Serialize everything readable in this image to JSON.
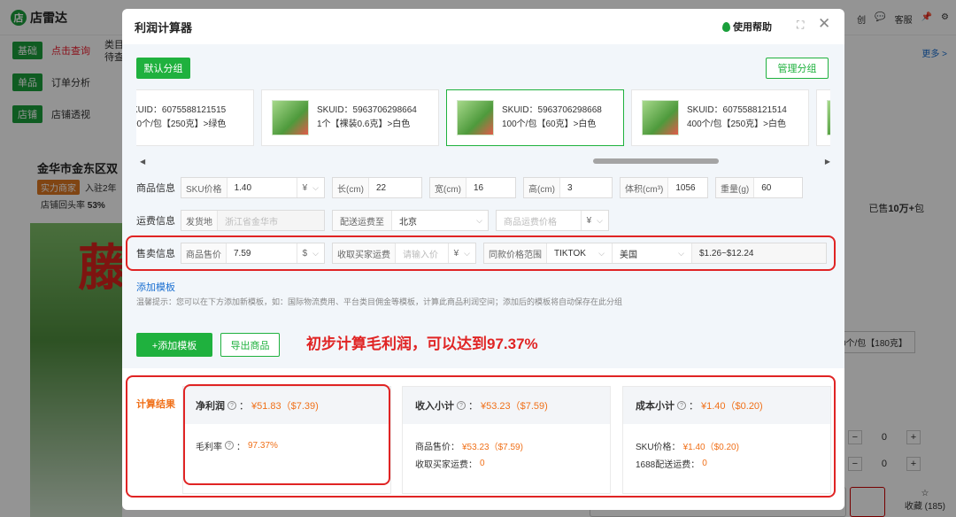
{
  "background": {
    "logo": "店雷达",
    "top_right": [
      "创",
      "客服"
    ],
    "nav": [
      {
        "tag": "基础",
        "link": "点击查询",
        "link_red": true
      },
      {
        "tag": "单品",
        "link": "订单分析",
        "extra": "SKU"
      },
      {
        "tag": "店铺",
        "link": "店铺透视",
        "extra": "店铺"
      }
    ],
    "col_head_1": "类目",
    "col_head_2": "待查",
    "more": "更多 >",
    "shop_name": "金华市金东区双",
    "badge_strong": "实力商家",
    "badge_years": "入驻2年",
    "shop_stat_label": "店铺回头率",
    "shop_stat_value": "53%",
    "product_char": "藤",
    "sold_prefix": "已售",
    "sold_value": "10万+",
    "sold_suffix": "包",
    "variant": "0个/包【180克】",
    "stepper_value": "0",
    "fav": "收藏 (185)"
  },
  "modal": {
    "title": "利润计算器",
    "help": "使用帮助",
    "default_group": "默认分组",
    "manage_group": "管理分组",
    "sku_cards": [
      {
        "line1": "KUID：6075588121515",
        "line2": "00个/包【250克】>绿色",
        "active": false
      },
      {
        "line1": "SKUID：5963706298664",
        "line2": "1个【裸装0.6克】>白色",
        "active": false
      },
      {
        "line1": "SKUID：5963706298668",
        "line2": "100个/包【60克】>白色",
        "active": true
      },
      {
        "line1": "SKUID：6075588121514",
        "line2": "400个/包【250克】>白色",
        "active": false
      }
    ],
    "product_info": {
      "label": "商品信息",
      "sku_price_label": "SKU价格",
      "sku_price": "1.40",
      "currency": "¥",
      "length_label": "长(cm)",
      "length": "22",
      "width_label": "宽(cm)",
      "width": "16",
      "height_label": "高(cm)",
      "height": "3",
      "volume_label": "体积(cm³)",
      "volume": "1056",
      "weight_label": "重量(g)",
      "weight": "60"
    },
    "shipping_info": {
      "label": "运费信息",
      "origin_label": "发货地",
      "origin": "浙江省金华市",
      "dest_label": "配送运费至",
      "dest": "北京",
      "product_freight_placeholder": "商品运费价格",
      "currency": "¥"
    },
    "sales_info": {
      "label": "售卖信息",
      "price_label": "商品售价",
      "price": "7.59",
      "currency": "$",
      "buyer_freight_label": "收取买家运费",
      "buyer_freight_placeholder": "请输入价",
      "freight_currency": "¥",
      "range_label": "同款价格范围",
      "platform": "TIKTOK",
      "country": "美国",
      "range": "$1.26~$12.24"
    },
    "add_template_link": "添加模板",
    "tip": "温馨提示：您可以在下方添加新模板，如：国际物流费用、平台类目佣金等模板，计算此商品利润空间；添加后的模板将自动保存在此分组",
    "add_template_btn": "+添加模板",
    "export_btn": "导出商品",
    "annotation": "初步计算毛利润，可以达到97.37%",
    "results": {
      "title": "计算结果",
      "net_profit": {
        "label": "净利润",
        "value": "¥51.83（$7.39)"
      },
      "gross_margin": {
        "label": "毛利率",
        "value": "97.37%"
      },
      "income": {
        "label": "收入小计",
        "value": "¥53.23（$7.59)"
      },
      "income_price_label": "商品售价：",
      "income_price": "¥53.23（$7.59)",
      "income_freight_label": "收取买家运费：",
      "income_freight": "0",
      "cost": {
        "label": "成本小计",
        "value": "¥1.40（$0.20)"
      },
      "cost_sku_label": "SKU价格：",
      "cost_sku": "¥1.40（$0.20)",
      "cost_1688_label": "1688配送运费：",
      "cost_1688": "0"
    }
  },
  "colors": {
    "accent": "#1fb13e",
    "orange": "#f07019",
    "annotation_red": "#e02424"
  }
}
